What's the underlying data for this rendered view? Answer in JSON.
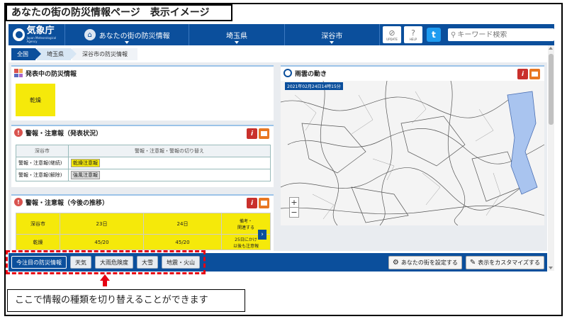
{
  "page_title": "あなたの街の防災情報ページ　表示イメージ",
  "header": {
    "logo_ja": "気象庁",
    "logo_en": "Japan Meteorological Agency",
    "home_label": "あなたの街の防災情報",
    "prefecture": "埼玉県",
    "city": "深谷市",
    "update_label": "UPDATE",
    "help_label": "HELP",
    "search_placeholder": "キーワード検索"
  },
  "breadcrumb": [
    "全国",
    "埼玉県",
    "深谷市の防災情報"
  ],
  "panels": {
    "current": {
      "title": "発表中の防災情報",
      "badge": "乾燥"
    },
    "status": {
      "title": "警報・注意報（発表状況）",
      "col_area": "深谷市",
      "col_switch": "警報・注意報・警報の切り替え",
      "rows": [
        {
          "label": "警報・注意報(継続)",
          "tag": "乾燥注意報",
          "color": "#f5e90a"
        },
        {
          "label": "警報・注意報(解除)",
          "tag": "強風注意報",
          "color": "#dddddd"
        }
      ]
    },
    "trend": {
      "title": "警報・注意報（今後の推移）",
      "col_area": "深谷市",
      "col_23": "23日",
      "col_24": "24日",
      "col_note": "備考・\n関連する",
      "row_label": "乾燥",
      "val_23": "45/20",
      "val_24": "45/20",
      "note": "25日にかけ\n以後も注意報"
    },
    "radar": {
      "title": "雨雲の動き",
      "datetime": "2021年02月24日14時15分",
      "zoom_in": "+",
      "zoom_out": "−"
    }
  },
  "bottom_tabs": [
    "今注目の防災情報",
    "天気",
    "大雨危険度",
    "大雪",
    "地震・火山"
  ],
  "right_buttons": {
    "set_city": "あなたの街を設定する",
    "customize": "表示をカスタマイズする"
  },
  "callout": "ここで情報の種類を切り替えることができます",
  "colors": {
    "brand_blue": "#0b4f9c",
    "alert_yellow": "#f5e90a",
    "highlight_red": "#e60012"
  }
}
